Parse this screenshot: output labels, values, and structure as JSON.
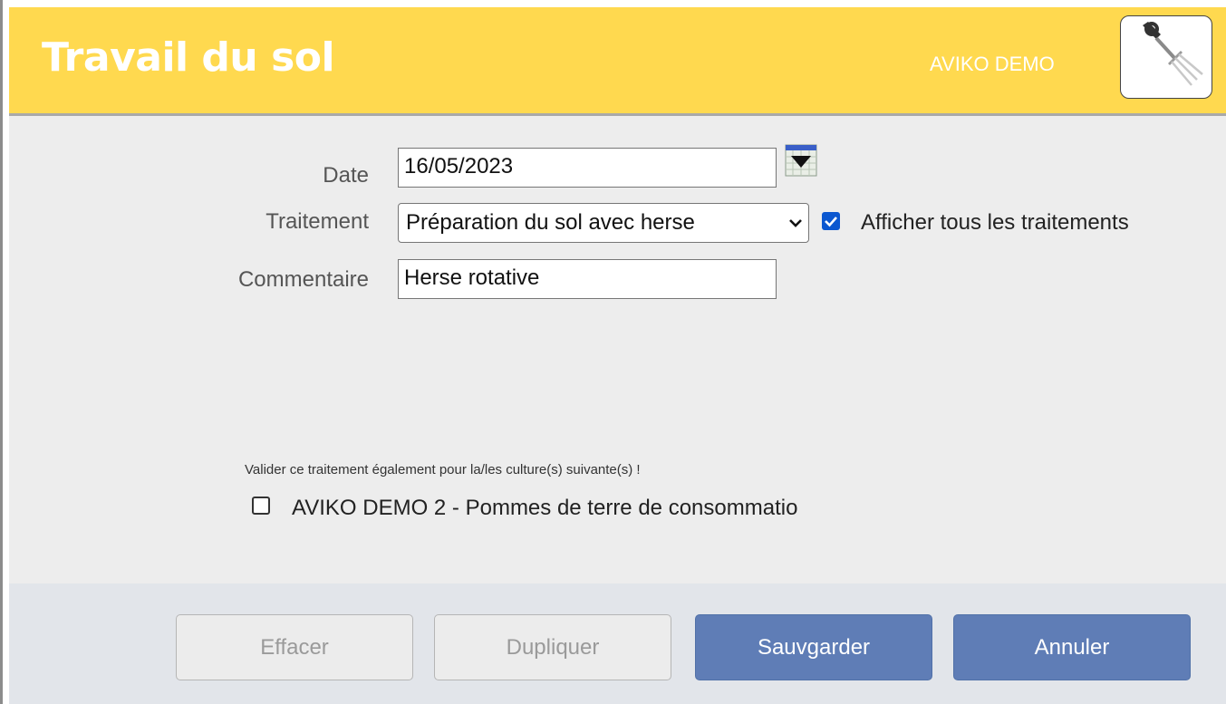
{
  "header": {
    "title": "Travail du sol",
    "farm_name": "AVIKO DEMO",
    "icon": "pitchfork-icon",
    "background_color": "#ffd94f"
  },
  "form": {
    "date": {
      "label": "Date",
      "value": "16/05/2023",
      "calendar_icon": "calendar-dropdown-icon"
    },
    "treatment": {
      "label": "Traitement",
      "selected": "Préparation du sol avec herse",
      "show_all_label": "Afficher tous les traitements",
      "show_all_checked": true
    },
    "comment": {
      "label": "Commentaire",
      "value": "Herse rotative"
    }
  },
  "apply_to_others": {
    "note": "Valider ce traitement également pour la/les culture(s) suivante(s) !",
    "crops": [
      {
        "label": "AVIKO DEMO 2 - Pommes de terre de consommatio",
        "checked": false
      }
    ]
  },
  "footer": {
    "buttons": {
      "clear": "Effacer",
      "duplicate": "Dupliquer",
      "save": "Sauvgarder",
      "cancel": "Annuler"
    },
    "primary_color": "#5f7db6"
  }
}
